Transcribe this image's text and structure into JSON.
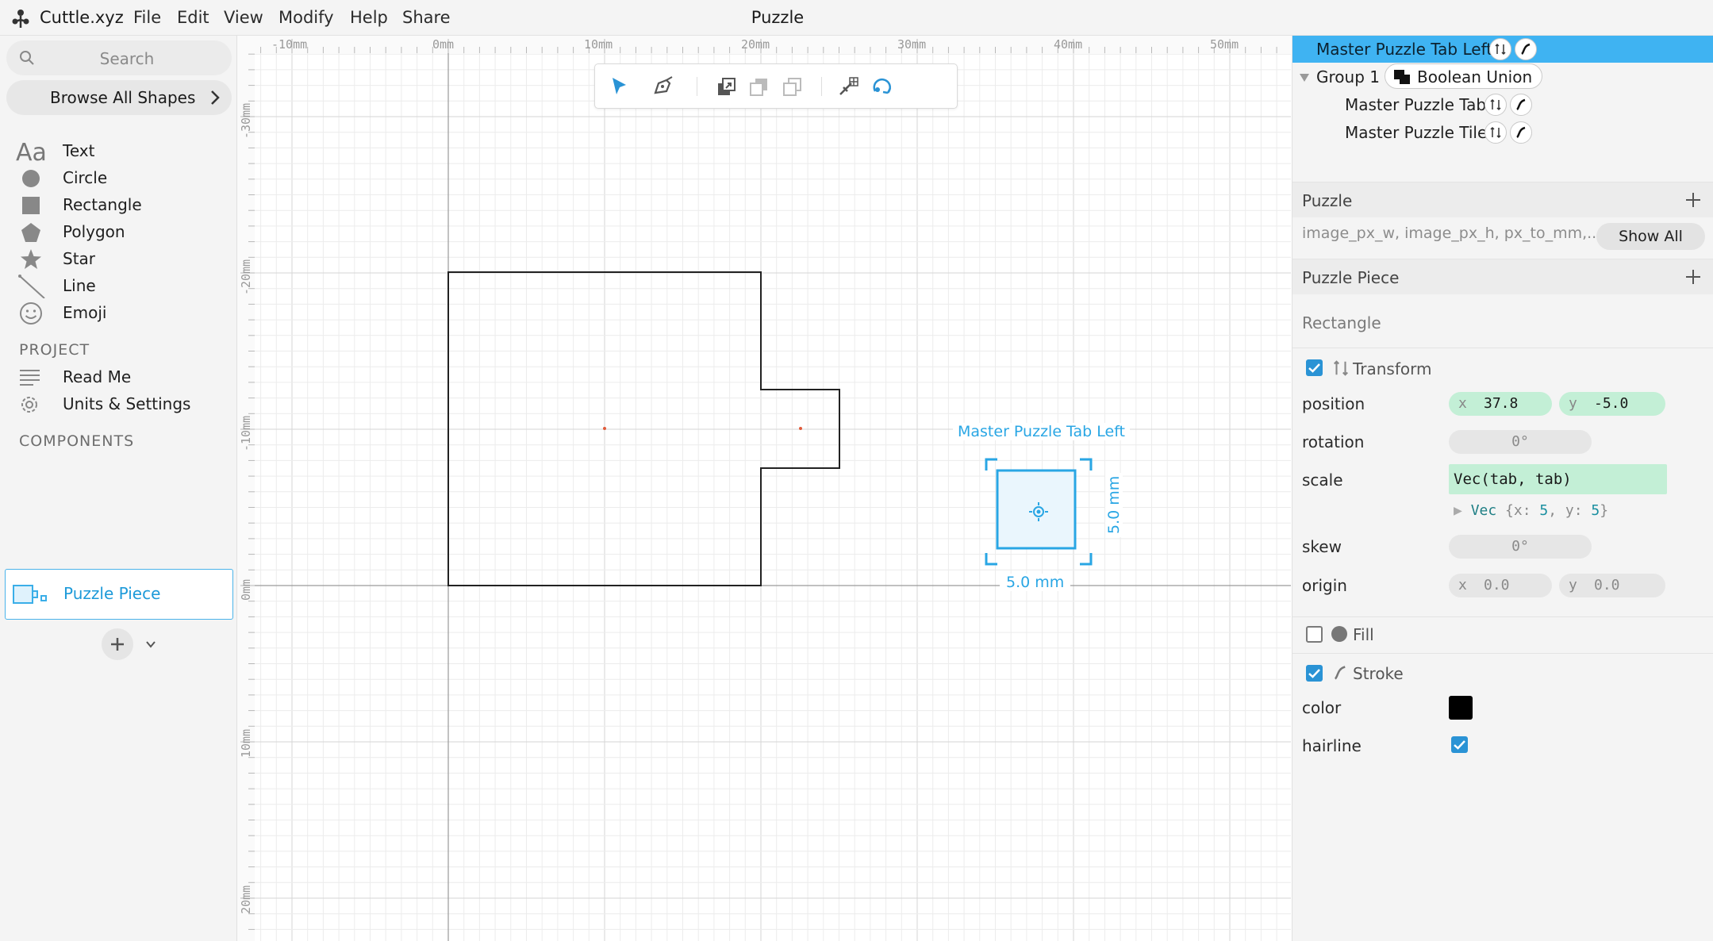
{
  "app": {
    "brand": "Cuttle.xyz",
    "menu": [
      "File",
      "Edit",
      "View",
      "Modify",
      "Help",
      "Share"
    ],
    "document_title": "Puzzle"
  },
  "sidebar": {
    "search_placeholder": "Search",
    "browse_label": "Browse All Shapes",
    "shapes": [
      {
        "label": "Text",
        "icon": "text-aa-icon"
      },
      {
        "label": "Circle",
        "icon": "circle-icon"
      },
      {
        "label": "Rectangle",
        "icon": "rectangle-icon"
      },
      {
        "label": "Polygon",
        "icon": "polygon-icon"
      },
      {
        "label": "Star",
        "icon": "star-icon"
      },
      {
        "label": "Line",
        "icon": "line-icon"
      },
      {
        "label": "Emoji",
        "icon": "emoji-icon"
      }
    ],
    "project_header": "PROJECT",
    "project_items": [
      {
        "label": "Read Me",
        "icon": "document-lines-icon"
      },
      {
        "label": "Units & Settings",
        "icon": "gear-icon"
      }
    ],
    "components_header": "COMPONENTS",
    "components": [
      {
        "label": "Puzzle Piece",
        "icon": "component-icon"
      }
    ]
  },
  "canvas": {
    "ruler_x": [
      "-10mm",
      "0mm",
      "10mm",
      "20mm",
      "30mm",
      "40mm",
      "50mm"
    ],
    "ruler_y": [
      "-30mm",
      "-20mm",
      "-10mm",
      "0mm",
      "10mm",
      "20mm"
    ],
    "toolbar_icons": [
      "select-arrow-icon",
      "pen-tool-icon",
      "bring-forward-icon",
      "send-backward-icon",
      "send-back-icon",
      "snap-magnet-icon",
      "rotate-tool-icon"
    ],
    "selection_label": "Master Puzzle Tab Left",
    "selection_width": "5.0 mm",
    "selection_height": "5.0 mm"
  },
  "layers": {
    "selected": "Master Puzzle Tab Left",
    "group": "Group 1",
    "boolean": "Boolean Union",
    "children": [
      "Master Puzzle Tab",
      "Master Puzzle Tile"
    ]
  },
  "inspector": {
    "puzzle_header": "Puzzle",
    "puzzle_params": "image_px_w, image_px_h, px_to_mm,...",
    "show_all": "Show All",
    "piece_header": "Puzzle Piece",
    "shape_type": "Rectangle",
    "transform_label": "Transform",
    "transform_enabled": true,
    "position_label": "position",
    "position_x": "37.8",
    "position_y": "-5.0",
    "rotation_label": "rotation",
    "rotation": "0°",
    "scale_label": "scale",
    "scale_expr": "Vec(tab, tab)",
    "scale_result": {
      "kw": "Vec",
      "x": "5",
      "y": "5"
    },
    "skew_label": "skew",
    "skew": "0°",
    "origin_label": "origin",
    "origin_x": "0.0",
    "origin_y": "0.0",
    "fill_label": "Fill",
    "fill_enabled": false,
    "stroke_label": "Stroke",
    "stroke_enabled": true,
    "color_label": "color",
    "stroke_color": "#000000",
    "hairline_label": "hairline",
    "hairline": true,
    "accent_color": "#3fb3f2"
  }
}
